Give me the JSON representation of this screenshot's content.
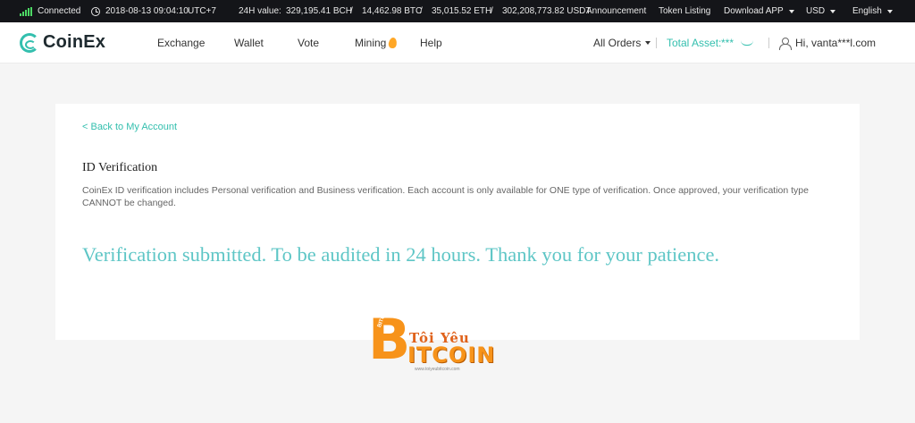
{
  "topbar": {
    "connection": "Connected",
    "datetime": "2018-08-13 09:04:10",
    "timezone": "UTC+7",
    "volume_label": "24H value:",
    "bch": "329,195.41 BCH",
    "btc": "14,462.98 BTC",
    "eth": "35,015.52 ETH",
    "usdt": "302,208,773.82 USDT",
    "divider": "/",
    "announcement": "Announcement",
    "token_listing": "Token Listing",
    "download_app": "Download APP",
    "currency": "USD",
    "language": "English"
  },
  "nav": {
    "logo": "CoinEx",
    "exchange": "Exchange",
    "wallet": "Wallet",
    "vote": "Vote",
    "mining": "Mining",
    "help": "Help",
    "all_orders": "All Orders",
    "total_asset_label": "Total Asset:",
    "total_asset_value": "***",
    "user_greeting": "Hi, vanta***l.com"
  },
  "card": {
    "back_link": "< Back to My Account",
    "title": "ID Verification",
    "description": "CoinEx ID verification includes Personal verification and Business verification. Each account is only available for ONE type of verification. Once approved, your verification type CANNOT be changed.",
    "status_message": "Verification submitted. To be audited in 24 hours. Thank you for your patience."
  },
  "watermark": {
    "logo_letter": "B",
    "logo_sub": "BITCOIN",
    "title": "Tôi Yêu",
    "word": "ITCOIN",
    "url": "www.toiyeubitcoin.com"
  },
  "colors": {
    "accent": "#33bfae",
    "status_text": "#5ec6c6",
    "topbar_bg": "#141519",
    "watermark_orange": "#f7931a"
  }
}
